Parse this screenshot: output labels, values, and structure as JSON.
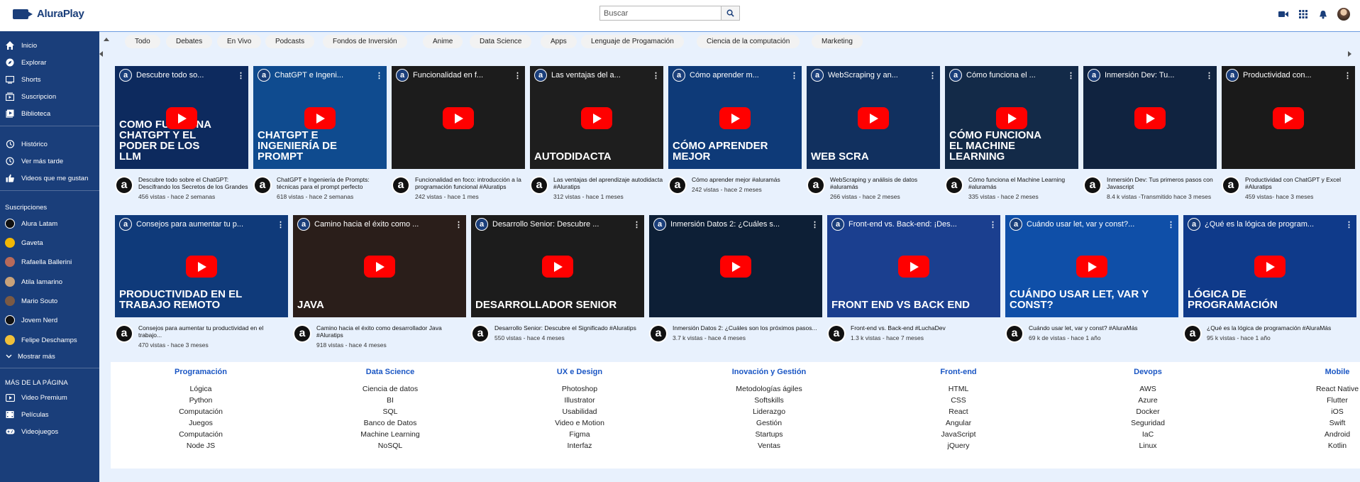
{
  "app": {
    "logo_text": "AluraPlay"
  },
  "search": {
    "placeholder": "Buscar"
  },
  "header_icons": [
    "video-camera-icon",
    "apps-grid-icon",
    "bell-icon",
    "avatar"
  ],
  "sidebar": {
    "main_items": [
      {
        "label": "Inicio",
        "icon": "home-icon"
      },
      {
        "label": "Explorar",
        "icon": "compass-icon"
      },
      {
        "label": "Shorts",
        "icon": "shorts-icon"
      },
      {
        "label": "Suscripcion",
        "icon": "subscriptions-icon"
      },
      {
        "label": "Biblioteca",
        "icon": "library-icon"
      }
    ],
    "library_items": [
      {
        "label": "Histórico",
        "icon": "history-icon"
      },
      {
        "label": "Ver más tarde",
        "icon": "clock-icon"
      },
      {
        "label": "Videos que me gustan",
        "icon": "thumbs-up-icon"
      }
    ],
    "subscriptions_heading": "Suscripciones",
    "subscriptions": [
      {
        "label": "Alura Latam",
        "color": "#1a1a1a"
      },
      {
        "label": "Gaveta",
        "color": "#f2b705"
      },
      {
        "label": "Rafaella Ballerini",
        "color": "#b86a5a"
      },
      {
        "label": "Atila Iamarino",
        "color": "#c9a27a"
      },
      {
        "label": "Mario Souto",
        "color": "#7b5a44"
      },
      {
        "label": "Jovem Nerd",
        "color": "#111111"
      },
      {
        "label": "Felipe Deschamps",
        "color": "#f0c03a"
      }
    ],
    "show_more": "Mostrar más",
    "more_heading": "MÁS DE LA PÁGINA",
    "more_items": [
      {
        "label": "Video Premium",
        "icon": "premium-video-icon"
      },
      {
        "label": "Películas",
        "icon": "film-icon"
      },
      {
        "label": "Videojuegos",
        "icon": "gamepad-icon"
      }
    ]
  },
  "chips": [
    "Todo",
    "Debates",
    "En Vivo",
    "Podcasts",
    "Fondos de Inversión",
    "Anime",
    "Data Science",
    "Apps",
    "Lenguaje de Progamación",
    "Ciencia de la computación",
    "Marketing"
  ],
  "videos_row1": [
    {
      "thumb_title": "Descubre todo so...",
      "big": "COMO FUNCIONA CHATGPT Y EL PODER DE LOS LLM",
      "bg": "#0d2a5e",
      "title": "Descubre todo sobre el ChatGPT: Descifrando los Secretos de los Grandes",
      "meta": "456 vistas - hace 2 semanas"
    },
    {
      "thumb_title": "ChatGPT e Ingeni...",
      "big": "CHATGPT E INGENIERÍA DE PROMPT",
      "bg": "#0f4b8f",
      "title": "ChatGPT e Ingeniería de Prompts: técnicas para el prompt perfecto",
      "meta": "618 vistas - hace 2 semanas"
    },
    {
      "thumb_title": "Funcionalidad en f...",
      "big": "",
      "bg": "#1c1c1c",
      "title": "Funcionalidad en foco: introducción a la programación funcional #Aluratips",
      "meta": "242 vistas - hace 1 mes"
    },
    {
      "thumb_title": "Las ventajas del a...",
      "big": "AUTODIDACTA",
      "bg": "#1e1e1e",
      "title": "Las ventajas del aprendizaje autodidacta #Aluratips",
      "meta": "312 vistas - hace 1 meses"
    },
    {
      "thumb_title": "Cómo aprender m...",
      "big": "CÓMO APRENDER MEJOR",
      "bg": "#0e3a78",
      "title": "Cómo aprender mejor #aluramás",
      "meta": "242 vistas - hace 2 meses"
    },
    {
      "thumb_title": "WebScraping y an...",
      "big": "WEB SCRA",
      "bg": "#11305f",
      "title": "WebScraping y análisis de datos #aluramás",
      "meta": "266 vistas - hace 2 meses"
    },
    {
      "thumb_title": "Cómo funciona el ...",
      "big": "CÓMO FUNCIONA EL MACHINE LEARNING",
      "bg": "#132a48",
      "title": "Cómo funciona el Machine Learning #aluramás",
      "meta": "335 vistas - hace 2 meses"
    },
    {
      "thumb_title": "Inmersión Dev: Tu...",
      "big": "",
      "bg": "#102340",
      "title": "Inmersión Dev: Tus primeros pasos con Javascript",
      "meta": "8.4 k vistas -Transmitido hace 3 meses"
    },
    {
      "thumb_title": "Productividad con...",
      "big": "",
      "bg": "#1a1a1a",
      "title": "Productividad con ChatGPT y Excel #Aluratips",
      "meta": "459 vistas- hace 3 meses"
    }
  ],
  "videos_row2": [
    {
      "thumb_title": "Consejos para aumentar tu p...",
      "big": "PRODUCTIVIDAD EN EL TRABAJO REMOTO",
      "bg": "#0f3a7a",
      "title": "Consejos para aumentar tu productividad en el trabajo...",
      "meta": "470 vistas - hace 3 meses"
    },
    {
      "thumb_title": "Camino hacia el éxito como ...",
      "big": "JAVA",
      "bg": "#2a1e1a",
      "title": "Camino hacia el éxito como desarrollador Java #Aluratips",
      "meta": "918 vistas - hace 4 meses"
    },
    {
      "thumb_title": "Desarrollo Senior: Descubre ...",
      "big": "DESARROLLADOR SENIOR",
      "bg": "#1c1c1c",
      "title": "Desarrollo Senior: Descubre el Significado #Aluratips",
      "meta": "550 vistas - hace 4 meses"
    },
    {
      "thumb_title": "Inmersión Datos 2: ¿Cuáles s...",
      "big": "",
      "bg": "#0d1f36",
      "title": "Inmersión Datos 2: ¿Cuáles son los próximos pasos...",
      "meta": "3.7 k vistas - hace 4 meses"
    },
    {
      "thumb_title": "Front-end vs. Back-end: ¡Des...",
      "big": "FRONT END VS BACK END",
      "bg": "#1b3f8f",
      "title": "Front-end vs. Back-end #LuchaDev",
      "meta": "1.3 k vistas - hace 7 meses"
    },
    {
      "thumb_title": "Cuándo usar let, var y const?...",
      "big": "CUÁNDO USAR LET, VAR Y CONST?",
      "bg": "#0f4fa8",
      "title": "Cuándo usar let, var y const? #AluraMás",
      "meta": "69 k de vistas - hace 1 año"
    },
    {
      "thumb_title": "¿Qué es la lógica de program...",
      "big": "LÓGICA DE PROGRAMACIÓN",
      "bg": "#0f3a8a",
      "title": "¿Qué es la lógica de programación #AluraMás",
      "meta": "95 k vistas - hace 1 año"
    }
  ],
  "footer": [
    {
      "heading": "Programación",
      "links": [
        "Lógica",
        "Python",
        "Computación",
        "Juegos",
        "Computación",
        "Node JS"
      ]
    },
    {
      "heading": "Data Science",
      "links": [
        "Ciencia de datos",
        "BI",
        "SQL",
        "Banco de Datos",
        "Machine Learning",
        "NoSQL"
      ]
    },
    {
      "heading": "UX e Design",
      "links": [
        "Photoshop",
        "Illustrator",
        "Usabilidad",
        "Video e Motion",
        "Figma",
        "Interfaz"
      ]
    },
    {
      "heading": "Inovación y Gestión",
      "links": [
        "Metodologías ágiles",
        "Softskills",
        "Liderazgo",
        "Gestión",
        "Startups",
        "Ventas"
      ]
    },
    {
      "heading": "Front-end",
      "links": [
        "HTML",
        "CSS",
        "React",
        "Angular",
        "JavaScript",
        "jQuery"
      ]
    },
    {
      "heading": "Devops",
      "links": [
        "AWS",
        "Azure",
        "Docker",
        "Seguridad",
        "IaC",
        "Linux"
      ]
    },
    {
      "heading": "Mobile",
      "links": [
        "React Native",
        "Flutter",
        "iOS",
        "Swift",
        "Android",
        "Kotlin"
      ]
    }
  ],
  "colors": {
    "brand": "#1a3e7a",
    "link": "#1a56c4",
    "main_bg": "#e8f1fd",
    "play": "#ff0000"
  }
}
